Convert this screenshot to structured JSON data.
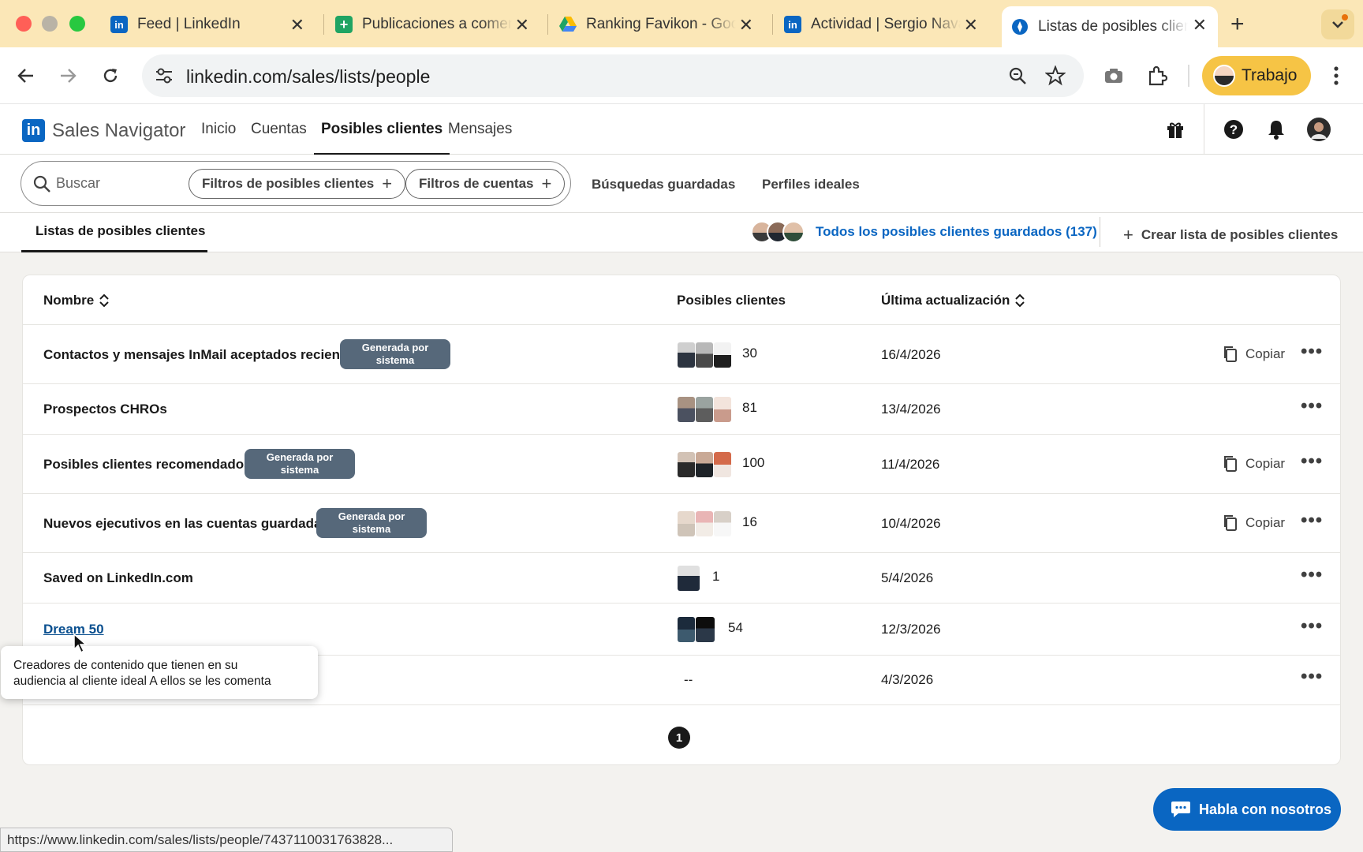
{
  "browser": {
    "tabs": [
      {
        "title": "Feed | LinkedIn",
        "icon": "linkedin-icon"
      },
      {
        "title": "Publicaciones a comentar",
        "icon": "sheets-icon"
      },
      {
        "title": "Ranking Favikon - Google Drive",
        "icon": "drive-icon"
      },
      {
        "title": "Actividad | Sergio Navarro",
        "icon": "linkedin-icon"
      },
      {
        "title": "Listas de posibles clientes",
        "icon": "sales-navigator-icon"
      }
    ],
    "url": "linkedin.com/sales/lists/people",
    "profile_label": "Trabajo",
    "status_url": "https://www.linkedin.com/sales/lists/people/7437110031763828..."
  },
  "header": {
    "brand": "Sales Navigator",
    "logo_text": "in",
    "nav": [
      "Inicio",
      "Cuentas",
      "Posibles clientes",
      "Mensajes"
    ],
    "active_nav": "Posibles clientes"
  },
  "filters": {
    "search_placeholder": "Buscar",
    "lead_filters": "Filtros de posibles clientes",
    "account_filters": "Filtros de cuentas",
    "saved_searches": "Búsquedas guardadas",
    "ideal_profiles": "Perfiles ideales"
  },
  "subnav": {
    "tab": "Listas de posibles clientes",
    "all_saved": "Todos los posibles clientes guardados (137)",
    "create_list": "Crear lista de posibles clientes"
  },
  "table": {
    "headers": {
      "name": "Nombre",
      "leads": "Posibles clientes",
      "updated": "Última actualización"
    },
    "copy_label": "Copiar",
    "rows": [
      {
        "name": "Contactos y mensajes InMail aceptados recien...",
        "badge_line1": "Generada por",
        "badge_line2": "sistema",
        "count": "30",
        "date": "16/4/2026",
        "copy": true
      },
      {
        "name": "Prospectos CHROs",
        "badge_line1": "",
        "badge_line2": "",
        "count": "81",
        "date": "13/4/2026",
        "copy": false
      },
      {
        "name": "Posibles clientes recomendados",
        "badge_line1": "Generada por",
        "badge_line2": "sistema",
        "count": "100",
        "date": "11/4/2026",
        "copy": true
      },
      {
        "name": "Nuevos ejecutivos en las cuentas guardadas",
        "badge_line1": "Generada por",
        "badge_line2": "sistema",
        "count": "16",
        "date": "10/4/2026",
        "copy": true
      },
      {
        "name": "Saved on LinkedIn.com",
        "badge_line1": "",
        "badge_line2": "",
        "count": "1",
        "date": "5/4/2026",
        "copy": false
      },
      {
        "name": "Dream 50",
        "badge_line1": "",
        "badge_line2": "",
        "count": "54",
        "date": "12/3/2026",
        "copy": false
      },
      {
        "name": "",
        "badge_line1": "",
        "badge_line2": "",
        "count": "--",
        "date": "4/3/2026",
        "copy": false
      }
    ],
    "page": "1"
  },
  "tooltip": {
    "line1": "Creadores de contenido que tienen en su",
    "line2": "audiencia al cliente ideal A ellos se les comenta"
  },
  "chat": {
    "label": "Habla con nosotros"
  },
  "colors": {
    "tabbar": "#fbe7b7",
    "linkedin_blue": "#0a66c2",
    "badge": "#56687a",
    "profile_pill": "#f6c445"
  }
}
